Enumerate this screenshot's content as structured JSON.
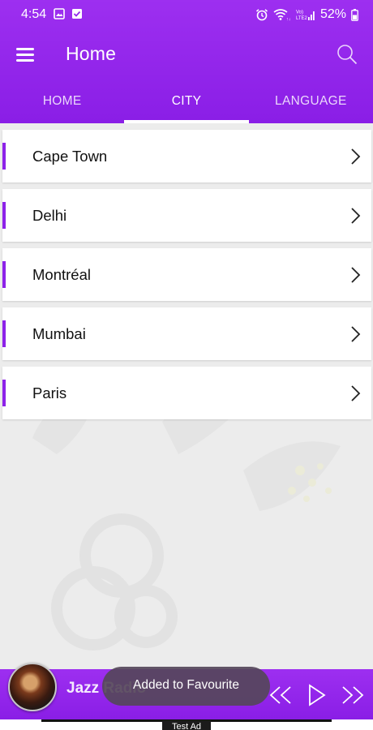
{
  "status_bar": {
    "time": "4:54",
    "battery_percent": "52%",
    "icons": [
      "image-icon",
      "check-icon",
      "alarm-icon",
      "wifi-icon",
      "signal-icon",
      "battery-icon"
    ]
  },
  "app_bar": {
    "title": "Home",
    "menu_icon": "hamburger-menu-icon",
    "search_icon": "search-icon"
  },
  "tabs": [
    {
      "label": "HOME",
      "active": false
    },
    {
      "label": "CITY",
      "active": true
    },
    {
      "label": "LANGUAGE",
      "active": false
    }
  ],
  "cities": [
    {
      "label": "Cape Town"
    },
    {
      "label": "Delhi"
    },
    {
      "label": "Montréal"
    },
    {
      "label": "Mumbai"
    },
    {
      "label": "Paris"
    }
  ],
  "player": {
    "station": "Jazz Radio",
    "controls": [
      "rewind-icon",
      "play-icon",
      "fast-forward-icon"
    ]
  },
  "toast": {
    "message": "Added to Favourite"
  },
  "ad": {
    "label": "Test Ad"
  },
  "colors": {
    "accent": "#8d22e9",
    "header_top": "#9d2ff0",
    "header_bottom": "#8a1ee6"
  }
}
